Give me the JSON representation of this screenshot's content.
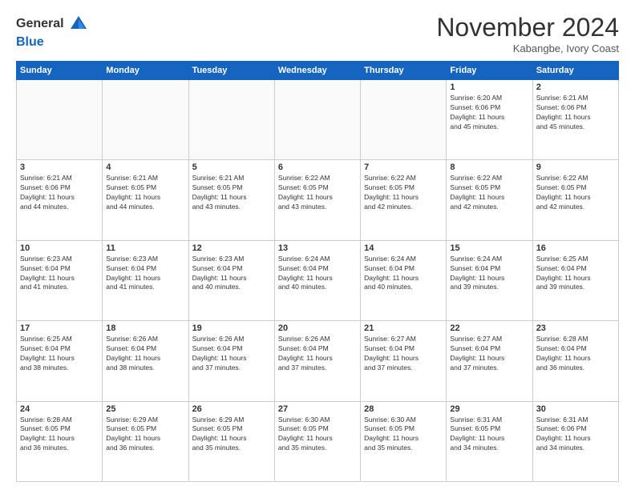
{
  "header": {
    "logo_general": "General",
    "logo_blue": "Blue",
    "month_title": "November 2024",
    "location": "Kabangbe, Ivory Coast"
  },
  "weekdays": [
    "Sunday",
    "Monday",
    "Tuesday",
    "Wednesday",
    "Thursday",
    "Friday",
    "Saturday"
  ],
  "weeks": [
    [
      {
        "day": "",
        "info": ""
      },
      {
        "day": "",
        "info": ""
      },
      {
        "day": "",
        "info": ""
      },
      {
        "day": "",
        "info": ""
      },
      {
        "day": "",
        "info": ""
      },
      {
        "day": "1",
        "info": "Sunrise: 6:20 AM\nSunset: 6:06 PM\nDaylight: 11 hours\nand 45 minutes."
      },
      {
        "day": "2",
        "info": "Sunrise: 6:21 AM\nSunset: 6:06 PM\nDaylight: 11 hours\nand 45 minutes."
      }
    ],
    [
      {
        "day": "3",
        "info": "Sunrise: 6:21 AM\nSunset: 6:06 PM\nDaylight: 11 hours\nand 44 minutes."
      },
      {
        "day": "4",
        "info": "Sunrise: 6:21 AM\nSunset: 6:05 PM\nDaylight: 11 hours\nand 44 minutes."
      },
      {
        "day": "5",
        "info": "Sunrise: 6:21 AM\nSunset: 6:05 PM\nDaylight: 11 hours\nand 43 minutes."
      },
      {
        "day": "6",
        "info": "Sunrise: 6:22 AM\nSunset: 6:05 PM\nDaylight: 11 hours\nand 43 minutes."
      },
      {
        "day": "7",
        "info": "Sunrise: 6:22 AM\nSunset: 6:05 PM\nDaylight: 11 hours\nand 42 minutes."
      },
      {
        "day": "8",
        "info": "Sunrise: 6:22 AM\nSunset: 6:05 PM\nDaylight: 11 hours\nand 42 minutes."
      },
      {
        "day": "9",
        "info": "Sunrise: 6:22 AM\nSunset: 6:05 PM\nDaylight: 11 hours\nand 42 minutes."
      }
    ],
    [
      {
        "day": "10",
        "info": "Sunrise: 6:23 AM\nSunset: 6:04 PM\nDaylight: 11 hours\nand 41 minutes."
      },
      {
        "day": "11",
        "info": "Sunrise: 6:23 AM\nSunset: 6:04 PM\nDaylight: 11 hours\nand 41 minutes."
      },
      {
        "day": "12",
        "info": "Sunrise: 6:23 AM\nSunset: 6:04 PM\nDaylight: 11 hours\nand 40 minutes."
      },
      {
        "day": "13",
        "info": "Sunrise: 6:24 AM\nSunset: 6:04 PM\nDaylight: 11 hours\nand 40 minutes."
      },
      {
        "day": "14",
        "info": "Sunrise: 6:24 AM\nSunset: 6:04 PM\nDaylight: 11 hours\nand 40 minutes."
      },
      {
        "day": "15",
        "info": "Sunrise: 6:24 AM\nSunset: 6:04 PM\nDaylight: 11 hours\nand 39 minutes."
      },
      {
        "day": "16",
        "info": "Sunrise: 6:25 AM\nSunset: 6:04 PM\nDaylight: 11 hours\nand 39 minutes."
      }
    ],
    [
      {
        "day": "17",
        "info": "Sunrise: 6:25 AM\nSunset: 6:04 PM\nDaylight: 11 hours\nand 38 minutes."
      },
      {
        "day": "18",
        "info": "Sunrise: 6:26 AM\nSunset: 6:04 PM\nDaylight: 11 hours\nand 38 minutes."
      },
      {
        "day": "19",
        "info": "Sunrise: 6:26 AM\nSunset: 6:04 PM\nDaylight: 11 hours\nand 37 minutes."
      },
      {
        "day": "20",
        "info": "Sunrise: 6:26 AM\nSunset: 6:04 PM\nDaylight: 11 hours\nand 37 minutes."
      },
      {
        "day": "21",
        "info": "Sunrise: 6:27 AM\nSunset: 6:04 PM\nDaylight: 11 hours\nand 37 minutes."
      },
      {
        "day": "22",
        "info": "Sunrise: 6:27 AM\nSunset: 6:04 PM\nDaylight: 11 hours\nand 37 minutes."
      },
      {
        "day": "23",
        "info": "Sunrise: 6:28 AM\nSunset: 6:04 PM\nDaylight: 11 hours\nand 36 minutes."
      }
    ],
    [
      {
        "day": "24",
        "info": "Sunrise: 6:28 AM\nSunset: 6:05 PM\nDaylight: 11 hours\nand 36 minutes."
      },
      {
        "day": "25",
        "info": "Sunrise: 6:29 AM\nSunset: 6:05 PM\nDaylight: 11 hours\nand 36 minutes."
      },
      {
        "day": "26",
        "info": "Sunrise: 6:29 AM\nSunset: 6:05 PM\nDaylight: 11 hours\nand 35 minutes."
      },
      {
        "day": "27",
        "info": "Sunrise: 6:30 AM\nSunset: 6:05 PM\nDaylight: 11 hours\nand 35 minutes."
      },
      {
        "day": "28",
        "info": "Sunrise: 6:30 AM\nSunset: 6:05 PM\nDaylight: 11 hours\nand 35 minutes."
      },
      {
        "day": "29",
        "info": "Sunrise: 6:31 AM\nSunset: 6:05 PM\nDaylight: 11 hours\nand 34 minutes."
      },
      {
        "day": "30",
        "info": "Sunrise: 6:31 AM\nSunset: 6:06 PM\nDaylight: 11 hours\nand 34 minutes."
      }
    ]
  ]
}
